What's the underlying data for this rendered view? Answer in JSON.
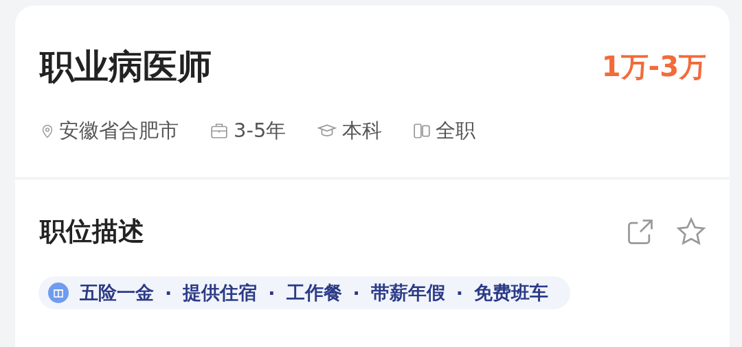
{
  "job": {
    "title": "职业病医师",
    "salary": "1万-3万",
    "meta": [
      {
        "kind": "location",
        "text": "安徽省合肥市"
      },
      {
        "kind": "experience",
        "text": "3-5年"
      },
      {
        "kind": "education",
        "text": "本科"
      },
      {
        "kind": "type",
        "text": "全职"
      }
    ]
  },
  "description": {
    "title": "职位描述",
    "benefits": [
      "五险一金",
      "提供住宿",
      "工作餐",
      "带薪年假",
      "免费班车"
    ],
    "separator": "·"
  }
}
